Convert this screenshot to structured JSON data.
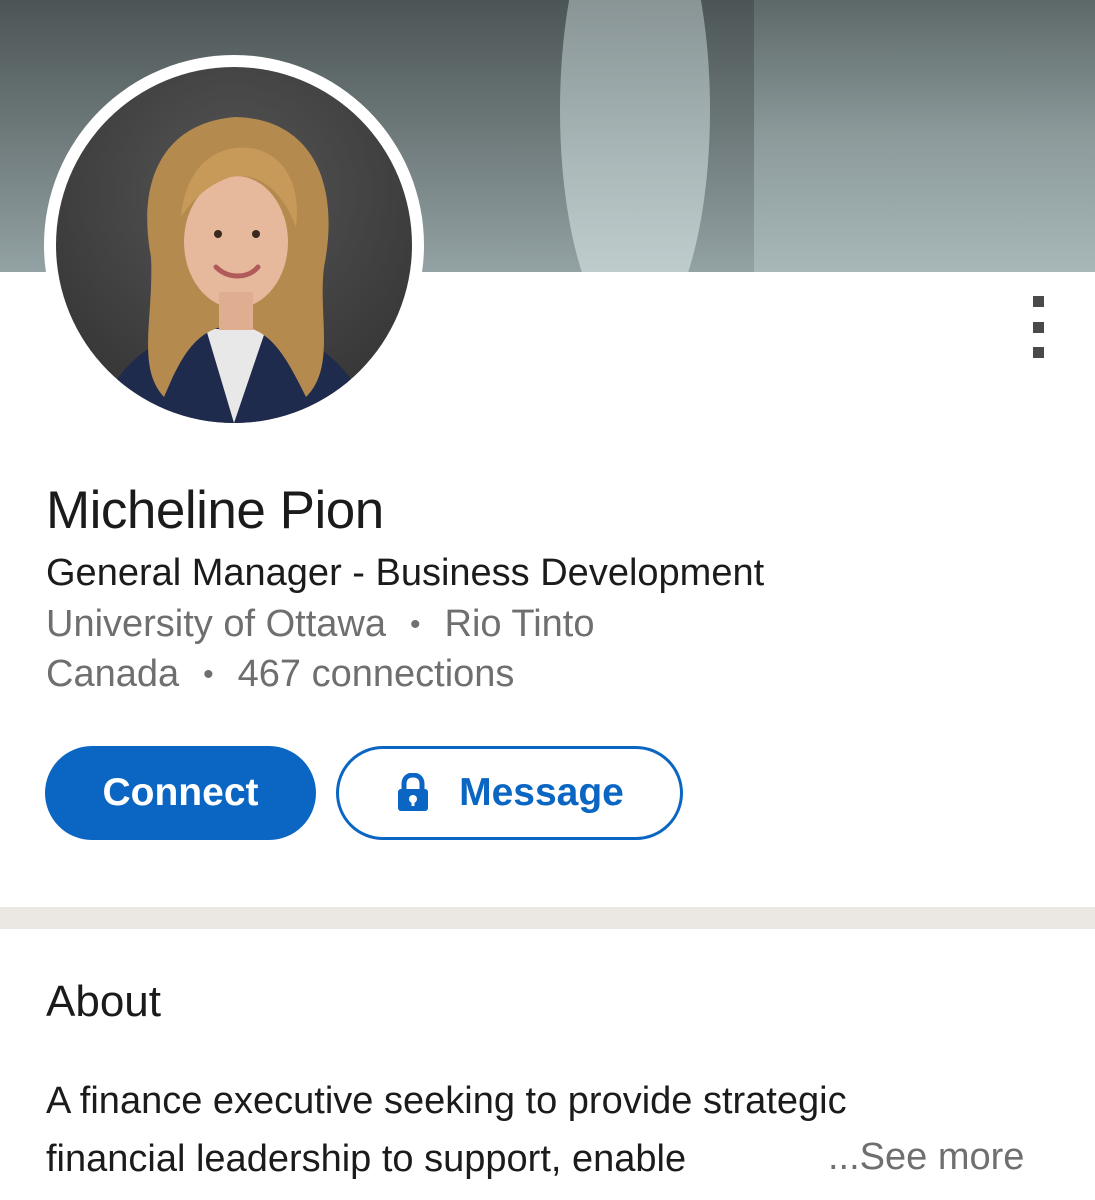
{
  "profile": {
    "name": "Micheline Pion",
    "headline": "General Manager - Business Development",
    "school": "University of Ottawa",
    "company": "Rio Tinto",
    "location": "Canada",
    "connections": "467 connections",
    "separator": "•"
  },
  "actions": {
    "connect_label": "Connect",
    "message_label": "Message",
    "message_icon": "lock-icon",
    "more_icon": "more-vertical-icon"
  },
  "about": {
    "title": "About",
    "line1": "A finance executive seeking to provide strategic",
    "line2": "financial leadership to support, enable",
    "see_more": "...See more"
  },
  "colors": {
    "accent": "#0a66c2",
    "divider": "#ebe7e2",
    "secondary_text": "#6f6f6f"
  }
}
